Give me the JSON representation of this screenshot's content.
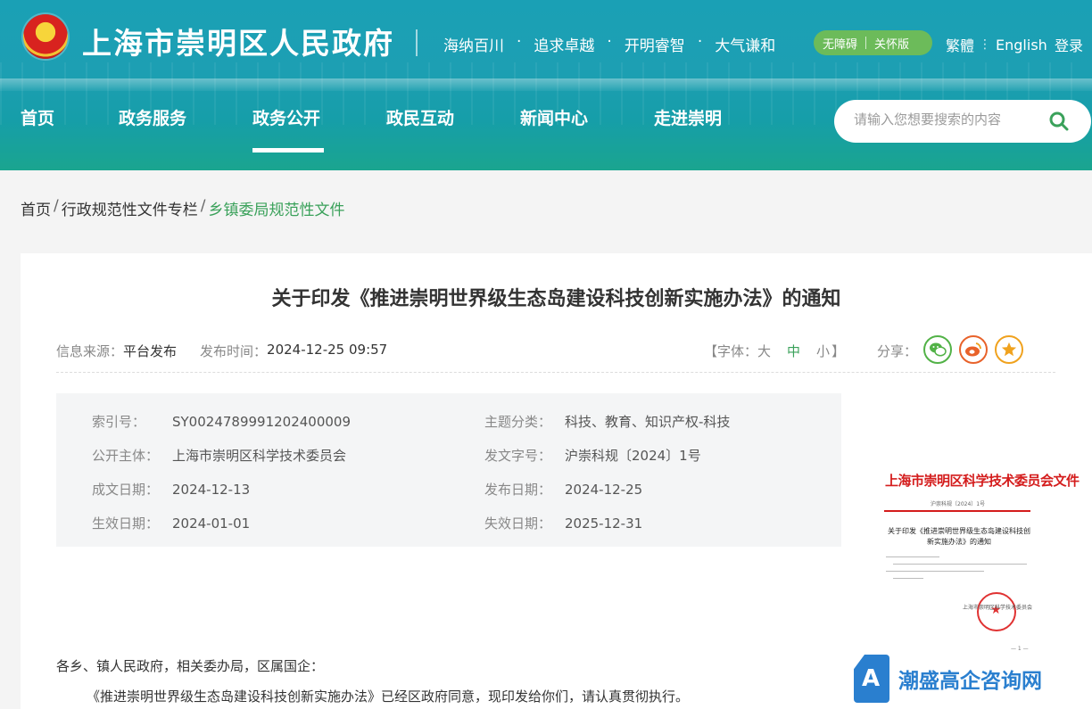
{
  "header": {
    "site_title": "上海市崇明区人民政府",
    "slogans": [
      "海纳百川",
      "追求卓越",
      "开明睿智",
      "大气谦和"
    ],
    "slogan_dot": "·",
    "access": {
      "barrier_free": "无障碍",
      "care": "关怀版"
    },
    "lang": {
      "traditional": "繁體",
      "english": "English"
    },
    "login": "登录"
  },
  "nav": {
    "items": [
      "首页",
      "政务服务",
      "政务公开",
      "政民互动",
      "新闻中心",
      "走进崇明"
    ],
    "active": "政务公开"
  },
  "search": {
    "placeholder": "请输入您想要搜索的内容"
  },
  "breadcrumb": {
    "items": [
      "首页",
      "行政规范性文件专栏",
      "乡镇委局规范性文件"
    ],
    "sep": "/"
  },
  "article": {
    "title": "关于印发《推进崇明世界级生态岛建设科技创新实施办法》的通知",
    "source_label": "信息来源：",
    "source": "平台发布",
    "time_label": "发布时间：",
    "time": "2024-12-25 09:57",
    "font_label_open": "【字体：",
    "font_large": "大",
    "font_mid": "中",
    "font_small": "小",
    "font_label_close": "】",
    "share_label": "分享："
  },
  "info": {
    "index_no": {
      "label": "索引号：",
      "value": "SY0024789991202400009"
    },
    "topic": {
      "label": "主题分类：",
      "value": "科技、教育、知识产权-科技"
    },
    "publisher": {
      "label": "公开主体：",
      "value": "上海市崇明区科学技术委员会"
    },
    "doc_no": {
      "label": "发文字号：",
      "value": "沪崇科规〔2024〕1号"
    },
    "written_date": {
      "label": "成文日期：",
      "value": "2024-12-13"
    },
    "publish_date": {
      "label": "发布日期：",
      "value": "2024-12-25"
    },
    "effective_date": {
      "label": "生效日期：",
      "value": "2024-01-01"
    },
    "expire_date": {
      "label": "失效日期：",
      "value": "2025-12-31"
    }
  },
  "thumbnail": {
    "header": "上海市崇明区科学技术委员会文件",
    "ref": "沪崇科规〔2024〕1号",
    "title": "关于印发《推进崇明世界级生态岛建设科技创新实施办法》的通知",
    "sign": "上海市崇明区科学技术委员会",
    "page": "— 1 —"
  },
  "body": {
    "salutation": "各乡、镇人民政府，相关委办局，区属国企：",
    "paragraph1": "《推进崇明世界级生态岛建设科技创新实施办法》已经区政府同意，现印发给你们，请认真贯彻执行。"
  },
  "watermark": {
    "text": "潮盛高企咨询网"
  },
  "colors": {
    "accent_green": "#3aa15a",
    "header_teal": "#1aa0b5",
    "access_green": "#6cbb5a"
  }
}
